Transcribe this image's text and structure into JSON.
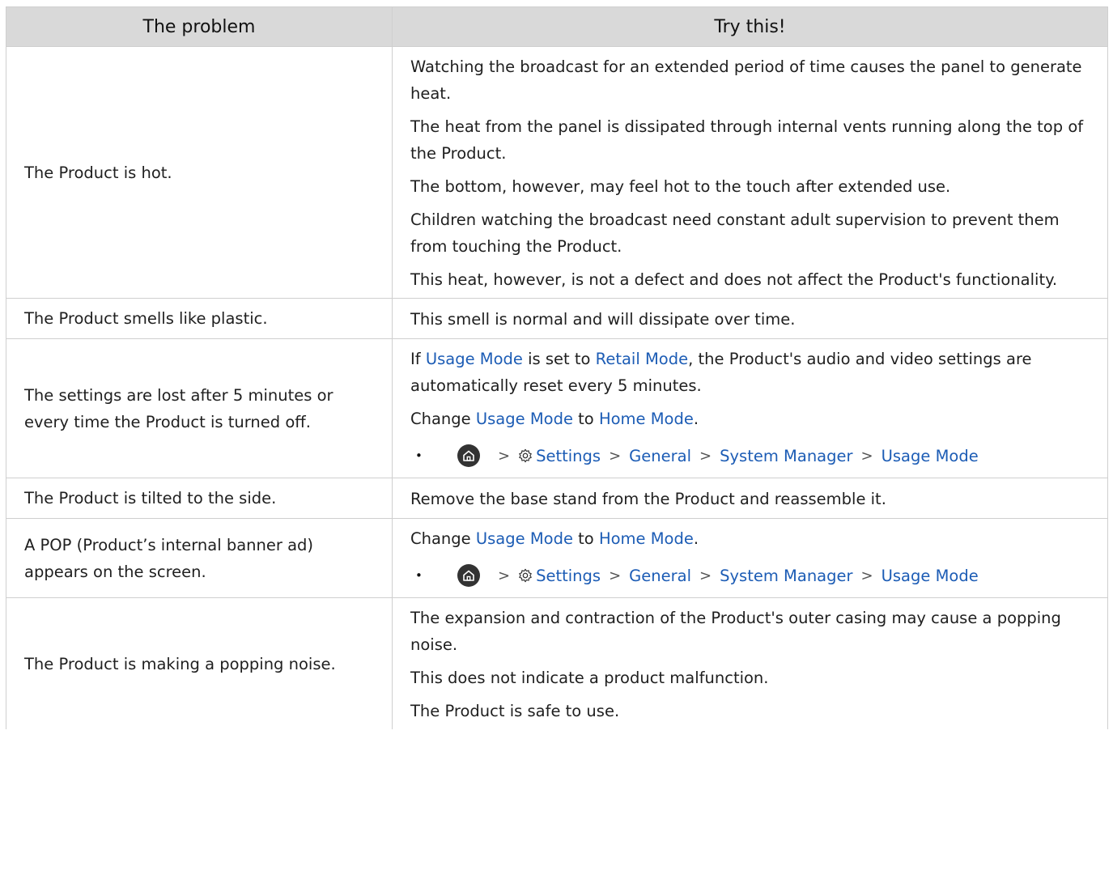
{
  "table": {
    "headers": {
      "problem": "The problem",
      "solution": "Try this!"
    },
    "rows": [
      {
        "problem": "The Product is hot.",
        "solutions": [
          "Watching the broadcast for an extended period of time causes the panel to generate heat.",
          "The heat from the panel is dissipated through internal vents running along the top of the Product.",
          "The bottom, however, may feel hot to the touch after extended use.",
          "Children watching the broadcast need constant adult supervision to prevent them from touching the Product.",
          "This heat, however, is not a defect and does not affect the Product's functionality."
        ]
      },
      {
        "problem": "The Product smells like plastic.",
        "solutions": [
          "This smell is normal and will dissipate over time."
        ]
      },
      {
        "problem": "The settings are lost after 5 minutes or every time the Product is turned off.",
        "solution_p1": {
          "t1": "If ",
          "usage_mode": "Usage Mode",
          "t2": " is set to ",
          "retail_mode": "Retail Mode",
          "t3": ", the Product's audio and video settings are automatically reset every 5 minutes."
        },
        "solution_p2": {
          "t1": "Change ",
          "usage_mode": "Usage Mode",
          "t2": " to ",
          "home_mode": "Home Mode",
          "t3": "."
        }
      },
      {
        "problem": "The Product is tilted to the side.",
        "solutions": [
          "Remove the base stand from the Product and reassemble it."
        ]
      },
      {
        "problem": "A POP (Product’s internal banner ad) appears on the screen.",
        "solution_p1": {
          "t1": "Change ",
          "usage_mode": "Usage Mode",
          "t2": " to ",
          "home_mode": "Home Mode",
          "t3": "."
        }
      },
      {
        "problem": "The Product is making a popping noise.",
        "solutions": [
          "The expansion and contraction of the Product's outer casing may cause a popping noise.",
          "This does not indicate a product malfunction.",
          "The Product is safe to use."
        ]
      }
    ]
  },
  "menu_path": {
    "bullet": "•",
    "separator": ">",
    "settings": "Settings",
    "general": "General",
    "system_manager": "System Manager",
    "usage_mode": "Usage Mode"
  },
  "colors": {
    "link": "#1c5cb5",
    "header_bg": "#d9d9d9",
    "border": "#cfcfcf"
  },
  "icons": [
    "home-icon",
    "gear-icon",
    "chevron-right-icon"
  ]
}
